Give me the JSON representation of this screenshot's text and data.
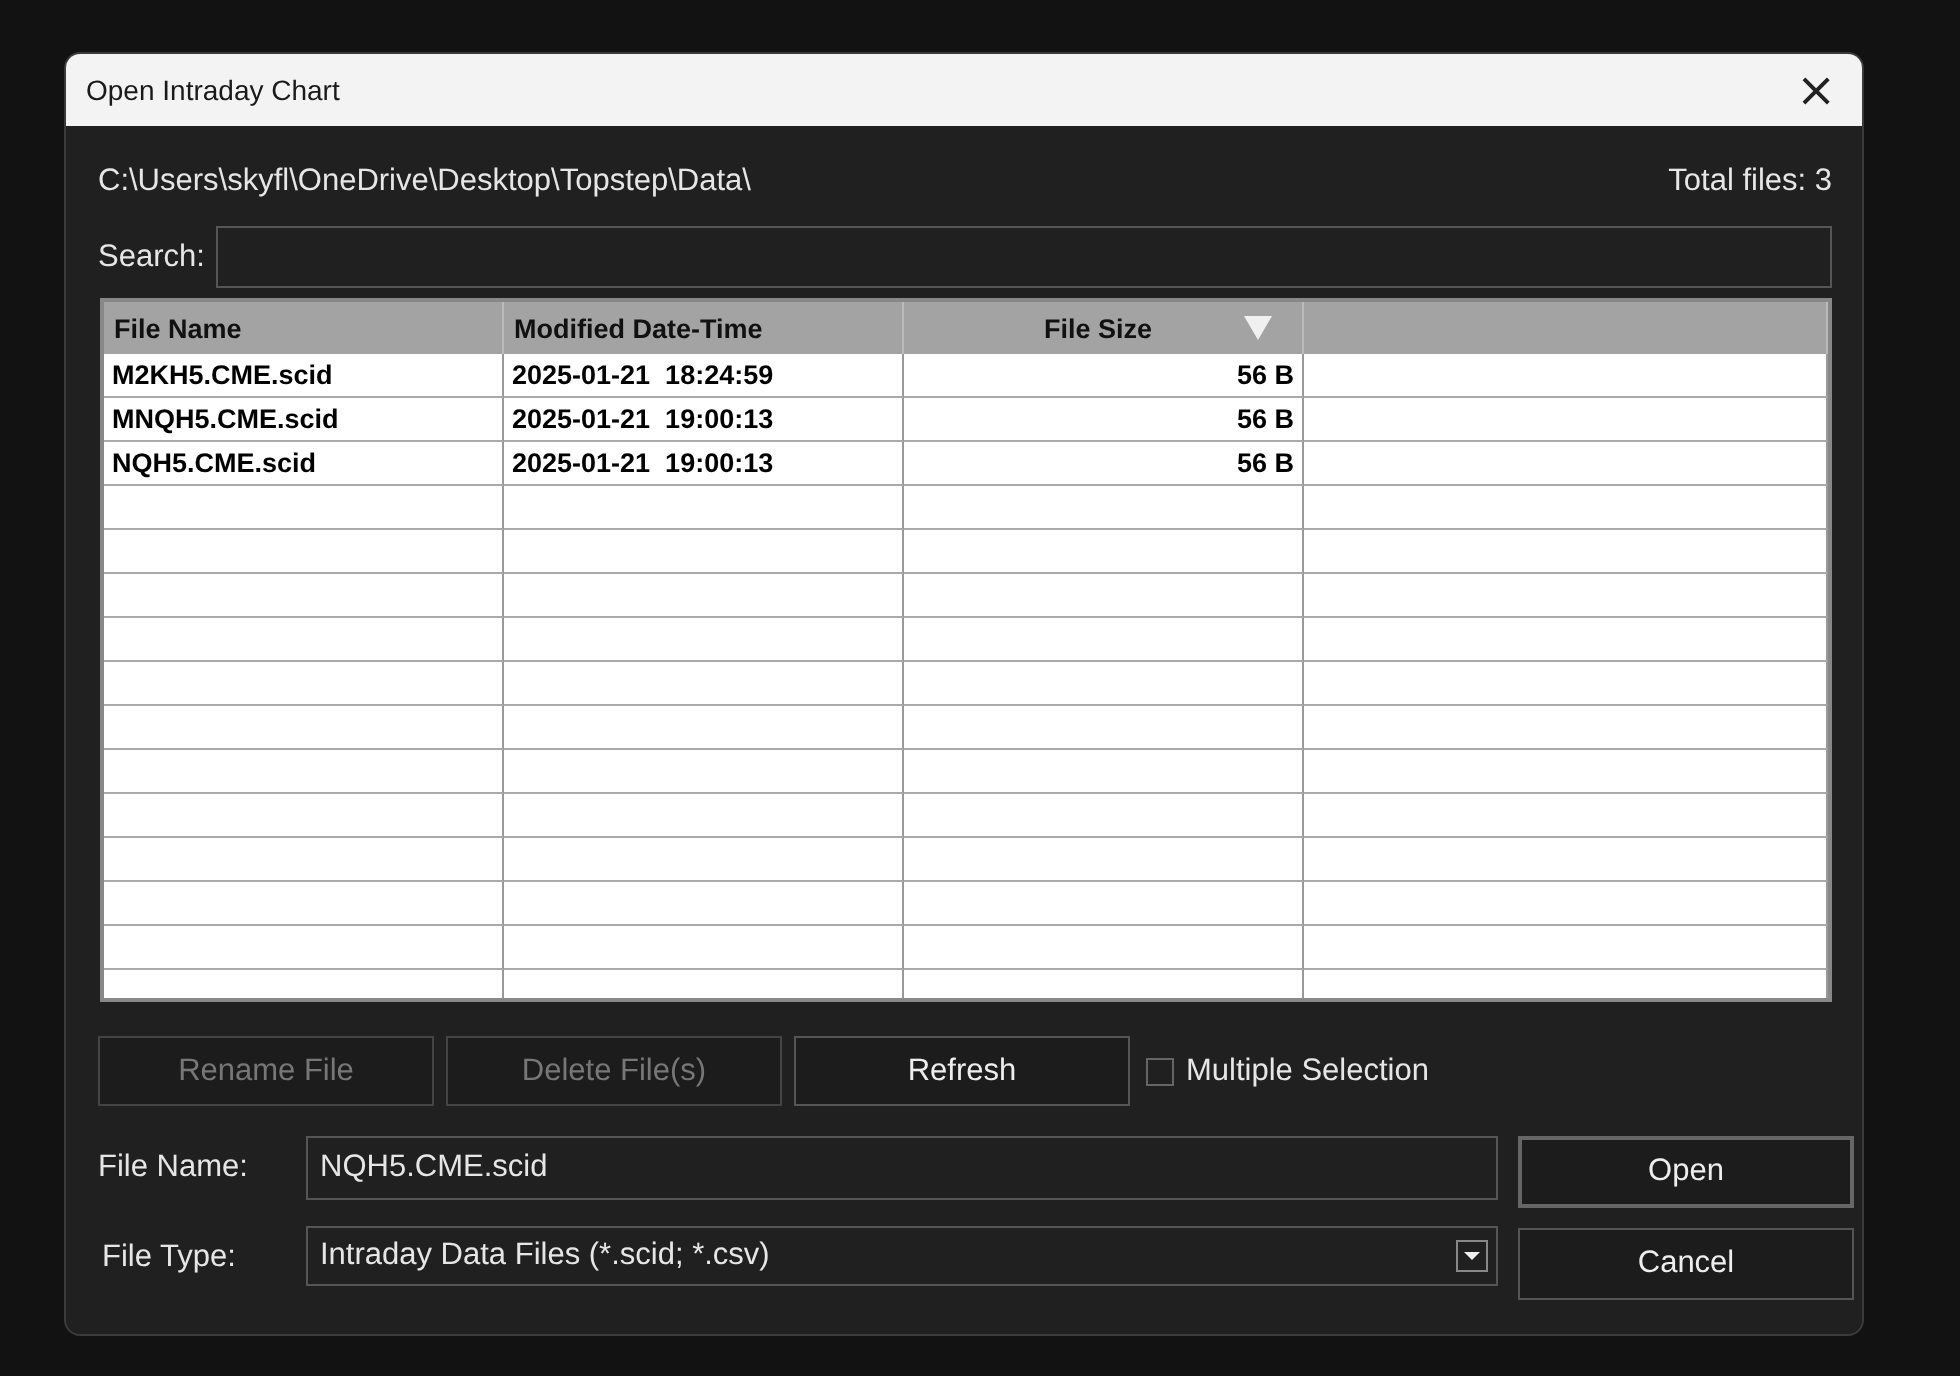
{
  "window": {
    "title": "Open Intraday Chart",
    "close": "×"
  },
  "path": "C:\\Users\\skyfl\\OneDrive\\Desktop\\Topstep\\Data\\",
  "total_files": "Total files: 3",
  "search": {
    "label": "Search:"
  },
  "table": {
    "columns": [
      {
        "label": "File Name",
        "sorted": false
      },
      {
        "label": "Modified Date-Time",
        "sorted": false
      },
      {
        "label": "File Size",
        "sorted": true
      }
    ],
    "rows": [
      [
        "M2KH5.CME.scid",
        "2025-01-21  18:24:59",
        "56 B"
      ],
      [
        "MNQH5.CME.scid",
        "2025-01-21  19:00:13",
        "56 B"
      ],
      [
        "NQH5.CME.scid",
        "2025-01-21  19:00:13",
        "56 B"
      ]
    ]
  },
  "actions": [
    {
      "label": "Rename File",
      "disabled": true
    },
    {
      "label": "Delete File(s)",
      "disabled": true
    },
    {
      "label": "Refresh",
      "disabled": false
    }
  ],
  "multiple_selection": {
    "label": "Multiple Selection",
    "checked": false
  },
  "file_name": {
    "label": "File Name:",
    "value": "NQH5.CME.scid"
  },
  "file_type": {
    "label": "File Type:",
    "value": "Intraday Data Files (*.scid; *.csv)"
  },
  "buttons": [
    "Open",
    "Cancel"
  ]
}
